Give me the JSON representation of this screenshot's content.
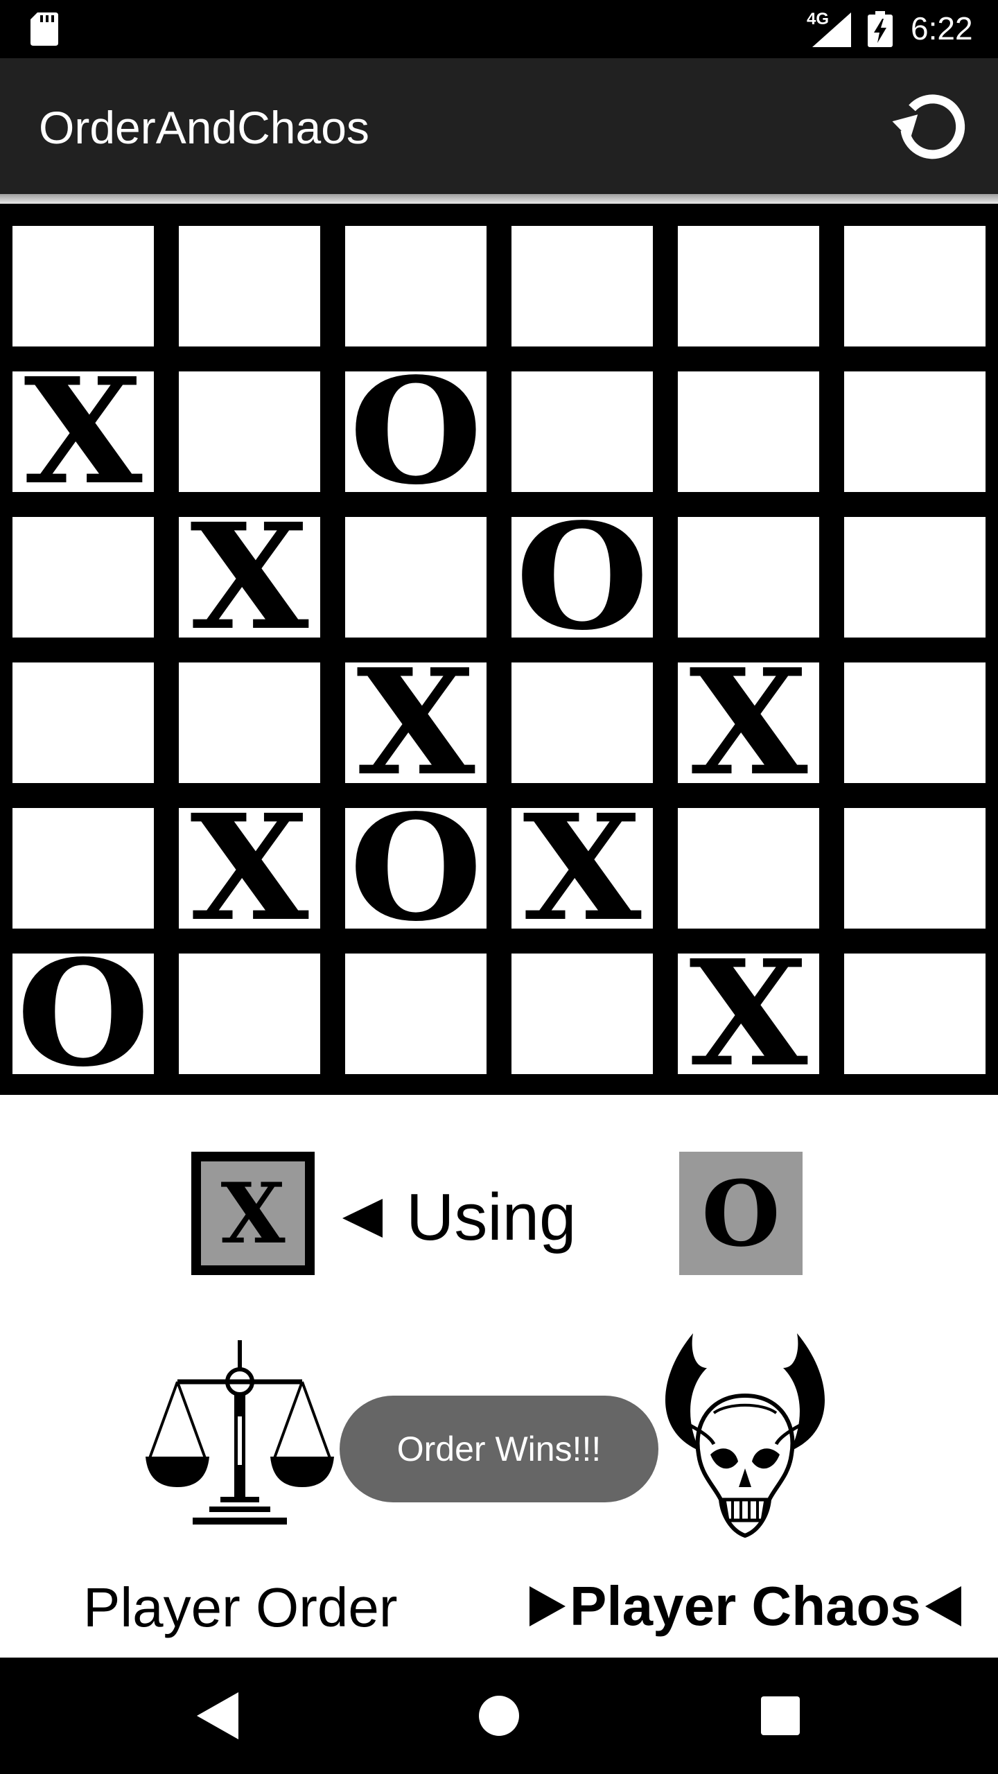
{
  "status_bar": {
    "network_label": "4G",
    "time": "6:22",
    "icons": [
      "sd-card-icon",
      "signal-icon",
      "battery-charging-icon"
    ]
  },
  "app_bar": {
    "title": "OrderAndChaos",
    "reset_icon": "refresh-icon"
  },
  "board": {
    "rows": [
      [
        "",
        "",
        "",
        "",
        "",
        ""
      ],
      [
        "X",
        "",
        "O",
        "",
        "",
        ""
      ],
      [
        "",
        "X",
        "",
        "O",
        "",
        ""
      ],
      [
        "",
        "",
        "X",
        "",
        "X",
        ""
      ],
      [
        "",
        "X",
        "O",
        "X",
        "",
        ""
      ],
      [
        "O",
        "",
        "",
        "",
        "X",
        ""
      ]
    ]
  },
  "symbol_selector": {
    "x_label": "X",
    "o_label": "O",
    "selected": "X",
    "using_label": "Using",
    "arrow_icon": "left-pointer-icon"
  },
  "players": {
    "order_label": "Player Order",
    "chaos_label": "Player Chaos",
    "current_turn": "chaos",
    "order_icon": "scales-of-justice-icon",
    "chaos_icon": "horned-skull-icon"
  },
  "toast": {
    "message": "Order Wins!!!"
  },
  "nav_bar": {
    "icons": [
      "back-icon",
      "home-icon",
      "recents-icon"
    ]
  },
  "colors": {
    "status_bar": "#000000",
    "app_bar": "#212121",
    "board_border": "#000000",
    "symbol_bg": "#999999",
    "toast_bg": "#666666"
  }
}
